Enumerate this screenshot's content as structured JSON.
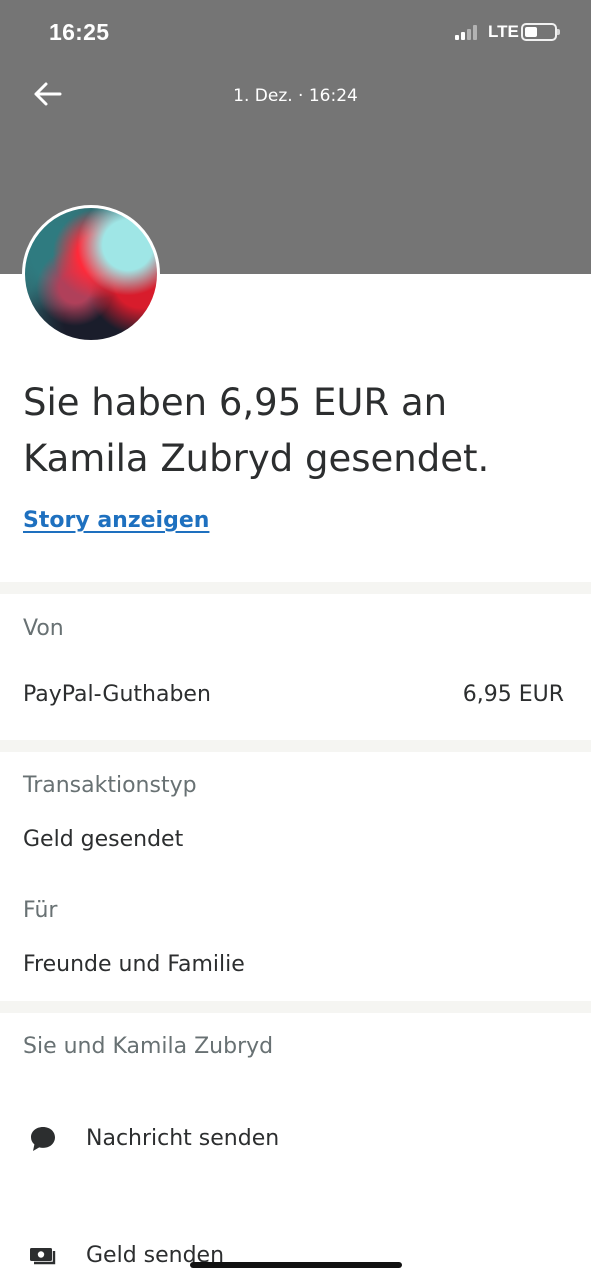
{
  "status_bar": {
    "time": "16:25",
    "network": "LTE"
  },
  "header": {
    "date": "1. Dez. · 16:24"
  },
  "title": "Sie haben 6,95 EUR an Kamila Zubryd gesendet.",
  "story_link": "Story anzeigen",
  "from_section": {
    "label": "Von",
    "source": "PayPal-Guthaben",
    "amount": "6,95 EUR"
  },
  "details": {
    "type_label": "Transaktionstyp",
    "type_value": "Geld gesendet",
    "for_label": "Für",
    "for_value": "Freunde und Familie"
  },
  "contact_section": {
    "heading": "Sie und Kamila Zubryd",
    "actions": [
      {
        "label": "Nachricht senden",
        "icon": "chat-bubble-icon"
      },
      {
        "label": "Geld senden",
        "icon": "money-icon"
      }
    ]
  }
}
